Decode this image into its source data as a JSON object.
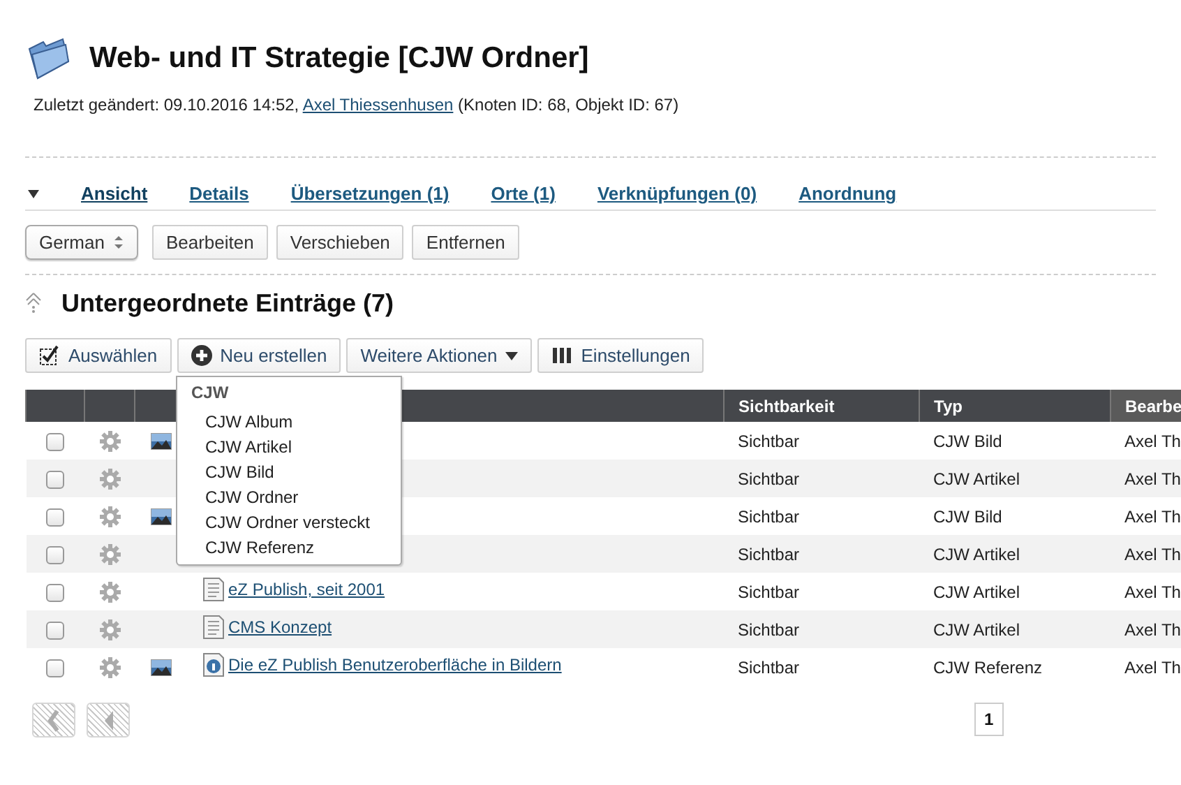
{
  "header": {
    "title": "Web- und IT Strategie [CJW Ordner]",
    "modified_label": "Zuletzt geändert: 09.10.2016 14:52,",
    "author": "Axel Thiessenhusen",
    "ids": "(Knoten ID: 68, Objekt ID: 67)"
  },
  "tabs": {
    "expanded": true,
    "items": [
      {
        "label": "Ansicht",
        "selected": true
      },
      {
        "label": "Details",
        "selected": false
      },
      {
        "label": "Übersetzungen (1)",
        "selected": false
      },
      {
        "label": "Orte (1)",
        "selected": false
      },
      {
        "label": "Verknüpfungen (0)",
        "selected": false
      },
      {
        "label": "Anordnung",
        "selected": false
      }
    ]
  },
  "actions": {
    "language": "German",
    "buttons": [
      "Bearbeiten",
      "Verschieben",
      "Entfernen"
    ]
  },
  "children": {
    "title": "Untergeordnete Einträge (7)",
    "toolbar": [
      {
        "kind": "select",
        "label": "Auswählen"
      },
      {
        "kind": "create",
        "label": "Neu erstellen"
      },
      {
        "kind": "more",
        "label": "Weitere Aktionen"
      },
      {
        "kind": "settings",
        "label": "Einstellungen"
      }
    ],
    "menu": {
      "group": "CJW",
      "items": [
        "CJW Album",
        "CJW Artikel",
        "CJW Bild",
        "CJW Ordner",
        "CJW Ordner versteckt",
        "CJW Referenz"
      ]
    },
    "columns": [
      "Sichtbarkeit",
      "Typ",
      "Bearbe"
    ],
    "rows": [
      {
        "checked": false,
        "has_image": true,
        "visibility": "Sichtbar",
        "type": "CJW Bild",
        "editor": "Axel Th"
      },
      {
        "checked": false,
        "has_image": false,
        "visibility": "Sichtbar",
        "type": "CJW Artikel",
        "editor": "Axel Th"
      },
      {
        "checked": false,
        "has_image": true,
        "visibility": "Sichtbar",
        "type": "CJW Bild",
        "editor": "Axel Th"
      },
      {
        "checked": false,
        "has_image": false,
        "visibility": "Sichtbar",
        "type": "CJW Artikel",
        "editor": "Axel Th"
      },
      {
        "checked": false,
        "has_image": false,
        "kind": "document",
        "name": "eZ Publish, seit 2001",
        "visibility": "Sichtbar",
        "type": "CJW Artikel",
        "editor": "Axel Th"
      },
      {
        "checked": false,
        "has_image": false,
        "kind": "document",
        "name": "CMS Konzept",
        "visibility": "Sichtbar",
        "type": "CJW Artikel",
        "editor": "Axel Th"
      },
      {
        "checked": false,
        "has_image": true,
        "kind": "reference",
        "name": "Die eZ Publish Benutzeroberfläche in Bildern",
        "visibility": "Sichtbar",
        "type": "CJW Referenz",
        "editor": "Axel Th"
      }
    ],
    "pages": [
      {
        "label": "1",
        "selected": true
      }
    ]
  }
}
